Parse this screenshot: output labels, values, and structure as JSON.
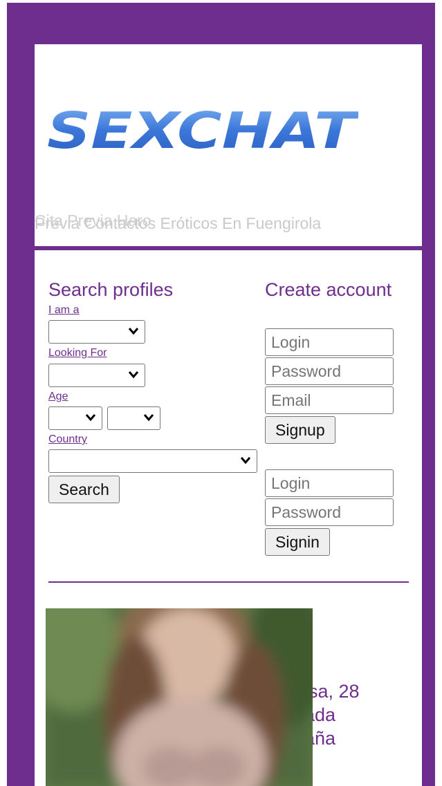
{
  "header": {
    "logo_text": "SEXCHAT",
    "subtitle": "Previa Contactos Eróticos En Fuengirola",
    "subtitle_overlay": "Cita Previa Haro"
  },
  "search": {
    "title": "Search profiles",
    "i_am_label": "I am a",
    "looking_for_label": "Looking For",
    "age_label": "Age",
    "country_label": "Country",
    "search_button": "Search"
  },
  "signup": {
    "title": "Create account",
    "login_placeholder": "Login",
    "password_placeholder": "Password",
    "email_placeholder": "Email",
    "signup_button": "Signup"
  },
  "signin": {
    "login_placeholder": "Login",
    "password_placeholder": "Password",
    "signin_button": "Signin"
  },
  "profile": {
    "line1": "isa, 28",
    "line2": "ada",
    "line3": "aña"
  },
  "colors": {
    "brand": "#6d2e8e",
    "logo_blue": "#3a73d6"
  }
}
